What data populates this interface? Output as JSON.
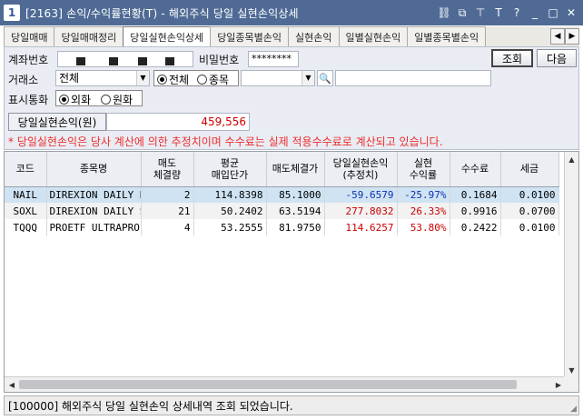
{
  "window": {
    "screen_no": "1",
    "title": "[2163] 손익/수익률현황(T) - 해외주식 당일 실현손익상세",
    "icons": [
      "link-icon",
      "copy-icon",
      "pin-icon",
      "font-icon",
      "help-icon",
      "minimize-icon",
      "maximize-icon",
      "close-icon"
    ],
    "icon_glyphs": [
      "⛓",
      "⧉",
      "⊤",
      "T",
      "?",
      "_",
      "□",
      "✕"
    ]
  },
  "tabs": [
    {
      "label": "당일매매",
      "active": false
    },
    {
      "label": "당일매매정리",
      "active": false
    },
    {
      "label": "당일실현손익상세",
      "active": true
    },
    {
      "label": "당일종목별손익",
      "active": false
    },
    {
      "label": "실현손익",
      "active": false
    },
    {
      "label": "일별실현손익",
      "active": false
    },
    {
      "label": "일별종목별손익",
      "active": false
    }
  ],
  "form": {
    "account_label": "계좌번호",
    "password_label": "비밀번호",
    "password_value": "********",
    "query_button": "조회",
    "next_button": "다음",
    "exchange_label": "거래소",
    "exchange_value": "전체",
    "scope_all": "전체",
    "scope_stock": "종목",
    "currency_label": "표시통화",
    "currency_foreign": "외화",
    "currency_krw": "원화",
    "pnl_label": "당일실현손익(원)",
    "pnl_value": "459,556",
    "notice": "* 당일실현손익은 당사 계산에 의한 추정치이며 수수료는 실제 적용수수료로 계산되고 있습니다."
  },
  "table": {
    "headers": [
      "코드",
      "종목명",
      "매도\n체결량",
      "평균\n매입단가",
      "매도체결가",
      "당일실현손익\n(추정치)",
      "실현\n수익률",
      "수수료",
      "세금"
    ],
    "rows": [
      [
        "NAIL",
        "DIREXION DAILY H",
        "2",
        "114.8398",
        "85.1000",
        "-59.6579",
        "-25.97%",
        "0.1684",
        "0.0100"
      ],
      [
        "SOXL",
        "DIREXION DAILY S",
        "21",
        "50.2402",
        "63.5194",
        "277.8032",
        "26.33%",
        "0.9916",
        "0.0700"
      ],
      [
        "TQQQ",
        "PROETF ULTRAPRO",
        "4",
        "53.2555",
        "81.9750",
        "114.6257",
        "53.80%",
        "0.2422",
        "0.0100"
      ]
    ]
  },
  "status": {
    "message": "[100000] 해외주식 당일 실현손익 상세내역 조회 되었습니다."
  },
  "colors": {
    "title_bar": "#4f6b95",
    "negative": "#0d30b7",
    "positive": "#cc0000",
    "notice": "#ee2d2d",
    "selected_row": "#cfe3f2"
  }
}
